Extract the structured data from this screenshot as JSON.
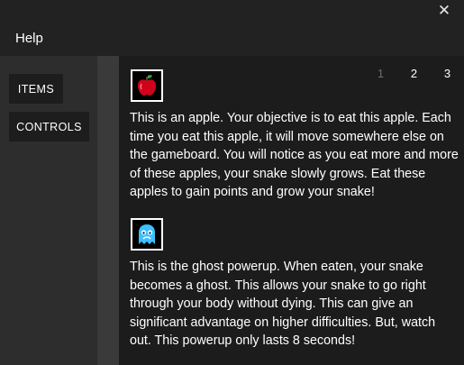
{
  "window": {
    "title": "Help",
    "close_label": "✕"
  },
  "sidebar": {
    "items_label": "ITEMS",
    "controls_label": "CONTROLS"
  },
  "pagination": {
    "pages": [
      "1",
      "2",
      "3"
    ],
    "current": "1"
  },
  "items": [
    {
      "icon": "apple-icon",
      "description": "This is an apple. Your objective  is to eat  this apple. Each time you eat this apple,  it will move somewhere else on the gameboard. You will notice as you eat more and more of these apples, your snake slowly grows. Eat these apples to gain points and grow your snake!"
    },
    {
      "icon": "ghost-icon",
      "description": "This is the ghost powerup. When eaten, your snake becomes a ghost. This allows your snake to go right through your body without dying. This can give an significant advantage on higher difficulties. But, watch out. This powerup only lasts 8 seconds!"
    }
  ],
  "colors": {
    "apple": "#d0021b",
    "ghost": "#3cc0ff"
  }
}
